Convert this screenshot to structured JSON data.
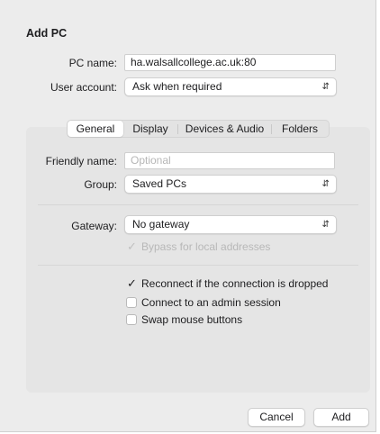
{
  "dialog": {
    "title": "Add PC",
    "pc_name_label": "PC name:",
    "pc_name_value": "ha.walsallcollege.ac.uk:80",
    "user_account_label": "User account:",
    "user_account_value": "Ask when required",
    "chevron_icon": "chevron-updown-icon"
  },
  "tabs": [
    {
      "label": "General",
      "selected": true
    },
    {
      "label": "Display",
      "selected": false
    },
    {
      "label": "Devices & Audio",
      "selected": false
    },
    {
      "label": "Folders",
      "selected": false
    }
  ],
  "general": {
    "friendly_name_label": "Friendly name:",
    "friendly_name_placeholder": "Optional",
    "group_label": "Group:",
    "group_value": "Saved PCs",
    "gateway_label": "Gateway:",
    "gateway_value": "No gateway",
    "bypass_label": "Bypass for local addresses",
    "options": [
      {
        "label": "Reconnect if the connection is dropped",
        "checked": true
      },
      {
        "label": "Connect to an admin session",
        "checked": false
      },
      {
        "label": "Swap mouse buttons",
        "checked": false
      }
    ]
  },
  "buttons": {
    "cancel": "Cancel",
    "add": "Add"
  }
}
